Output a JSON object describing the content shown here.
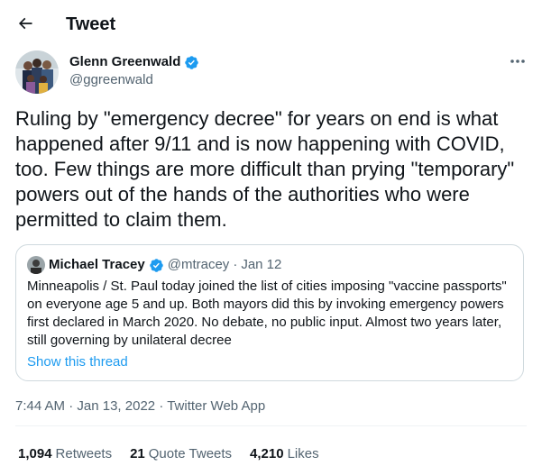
{
  "header": {
    "title": "Tweet"
  },
  "tweet": {
    "author_name": "Glenn Greenwald",
    "handle": "@ggreenwald",
    "text": "Ruling by \"emergency decree\" for years on end is what happened after 9/11 and is now happening with COVID, too. Few things are more difficult than prying \"temporary\" powers out of the hands of the authorities who were permitted to claim them.",
    "time": "7:44 AM",
    "date": "Jan 13, 2022",
    "source": "Twitter Web App"
  },
  "quote": {
    "author_name": "Michael Tracey",
    "handle": "@mtracey",
    "date": "Jan 12",
    "text": "Minneapolis / St. Paul today joined the list of cities imposing \"vaccine passports\" on everyone age 5 and up. Both mayors did this by invoking emergency powers first declared in March 2020. No debate, no public input. Almost two years later, still governing by unilateral decree",
    "show_thread": "Show this thread"
  },
  "stats": {
    "retweets": {
      "count": "1,094",
      "label": "Retweets"
    },
    "quote_tweets": {
      "count": "21",
      "label": "Quote Tweets"
    },
    "likes": {
      "count": "4,210",
      "label": "Likes"
    }
  },
  "separator": "·",
  "colors": {
    "accent": "#1d9bf0",
    "secondary_text": "#536471",
    "border": "#cfd9de"
  },
  "icons": {
    "back": "arrow-left-icon",
    "verified": "verified-badge-icon",
    "more": "more-horizontal-icon"
  }
}
